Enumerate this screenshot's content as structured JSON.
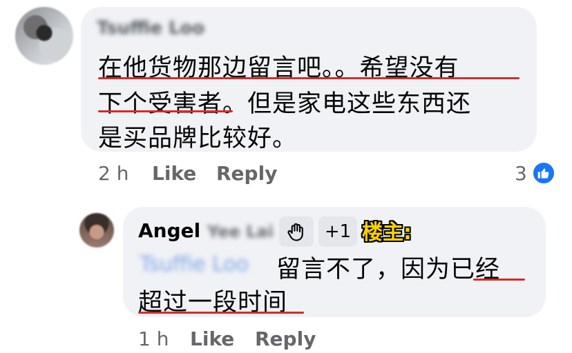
{
  "comment1": {
    "author": "Tsuffie Loo",
    "lines": [
      "在他货物那边留言吧。。希望没有",
      "下个受害者。但是家电这些东西还",
      "是买品牌比较好。"
    ],
    "time": "2 h",
    "like_label": "Like",
    "reply_label": "Reply",
    "reaction_count": "3",
    "reaction_icon": "thumbs-up-icon"
  },
  "reply1": {
    "author_first": "Angel",
    "author_rest": "Yee Lai",
    "badge_icon": "wave-hand-icon",
    "plus_badge": "+1",
    "host_tag": "楼主:",
    "mention": "Tsuffie Loo",
    "line1": "留言不了，因为已经",
    "line2": "超过一段时间",
    "time": "1 h",
    "like_label": "Like",
    "reply_label": "Reply"
  },
  "colors": {
    "bubble": "#f0f2f5",
    "meta_text": "#65676b",
    "underline": "#d42a2a",
    "like_blue": "#1877f2",
    "host_tag": "#ffd100"
  }
}
